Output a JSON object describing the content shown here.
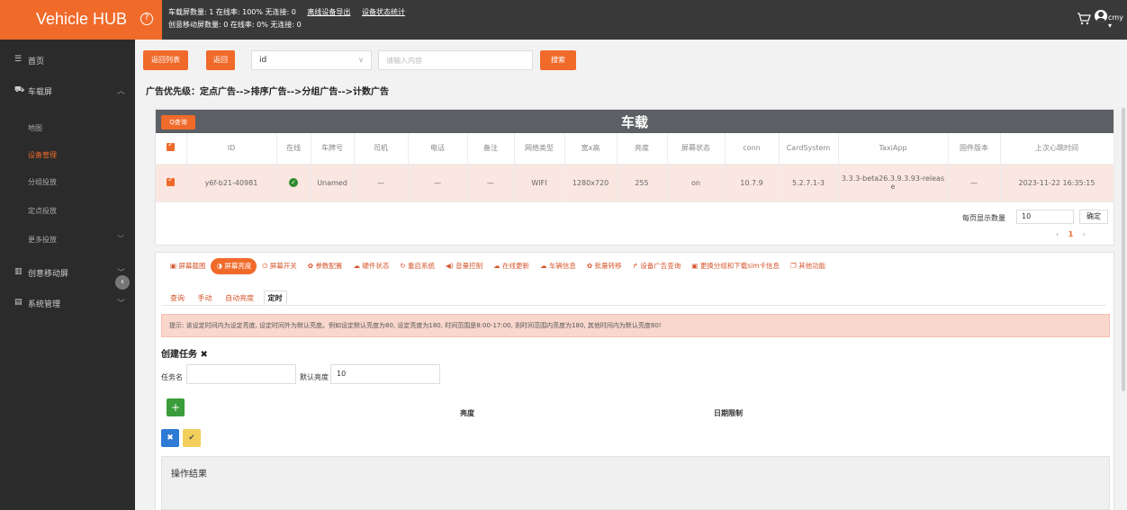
{
  "header": {
    "brand": "Vehicle HUB",
    "stats_line1": "车载屏数量: 1  在线率: 100%  无连接: 0",
    "link_export": "离线设备导出",
    "link_status": "设备状态统计",
    "stats_line2": "创意移动屏数量: 0  在线率: 0%  无连接: 0",
    "user_name": "cmy ▾"
  },
  "sidebar": {
    "home": "首页",
    "vehicle_screen": "车载屏",
    "sub_items": [
      "地图",
      "设备管理",
      "分组投放",
      "定点投放",
      "更多投放"
    ],
    "creative_screen": "创意移动屏",
    "system_mgmt": "系统管理"
  },
  "toolbar": {
    "back_list": "返回列表",
    "back": "返回",
    "select_value": "id",
    "search_placeholder": "请输入内容",
    "search_btn": "搜索"
  },
  "priority_text": "广告优先级：定点广告-->排序广告-->分组广告-->计数广告",
  "device_panel": {
    "query_btn": "Q查询",
    "title": "车载",
    "columns": [
      "",
      "ID",
      "在线",
      "车牌号",
      "司机",
      "电话",
      "备注",
      "网络类型",
      "宽x高",
      "亮度",
      "屏幕状态",
      "conn",
      "CardSystem",
      "TaxiApp",
      "固件版本",
      "上次心跳时间"
    ],
    "rows": [
      [
        "",
        "y6f-b21-40981",
        "",
        "Unamed",
        "—",
        "—",
        "—",
        "WIFI",
        "1280x720",
        "255",
        "on",
        "10.7.9",
        "5.2.7.1-3",
        "3.3.3-beta26.3.9.3.93-release",
        "—",
        "2023-11-22 16:35:15"
      ]
    ],
    "page_size_label": "每页显示数量",
    "page_size": "10",
    "confirm": "确定",
    "page_prev": "‹",
    "page_current": "1",
    "page_next": "›"
  },
  "control_panel": {
    "tabs": [
      "屏幕截图",
      "屏幕亮度",
      "屏幕开关",
      "参数配置",
      "硬件状态",
      "重启系统",
      "音量控制",
      "在线更新",
      "车辆信息",
      "批量转移",
      "设备广告查询",
      "更换分组和下载sim卡信息",
      "其他功能"
    ],
    "tab_icons": [
      "▣",
      "◑",
      "⏻",
      "✿",
      "☁",
      "↻",
      "◀)",
      "☁",
      "☁",
      "✿",
      "↱",
      "▣",
      "❐"
    ],
    "active_tab_index": 1,
    "subtabs": [
      "查询",
      "手动",
      "自动亮度",
      "定时"
    ],
    "active_subtab_index": 3,
    "tip": "提示: 该设定时间内为设定亮度, 设定时间外为默认亮度。例如设定默认亮度为80, 设定亮度为180, 时间范围是8:00-17:00, 则时间范围内亮度为180, 其他时间内为默认亮度80!",
    "create_task": "创建任务 ✖",
    "task_name_label": "任务名",
    "default_brightness_label": "默认亮度",
    "default_brightness_value": "10",
    "col_brightness": "亮度",
    "col_date_limit": "日期限制",
    "add_icon": "+",
    "cancel_icon": "✖",
    "confirm_icon": "✔",
    "result_title": "操作结果"
  },
  "colors": {
    "accent": "#f06a2a",
    "topbar": "#393939",
    "sidebar": "#2b2b2b",
    "panel_head": "#5c5f63",
    "row_highlight": "#fbe7e1",
    "tip_bg": "#f9d7cc"
  }
}
